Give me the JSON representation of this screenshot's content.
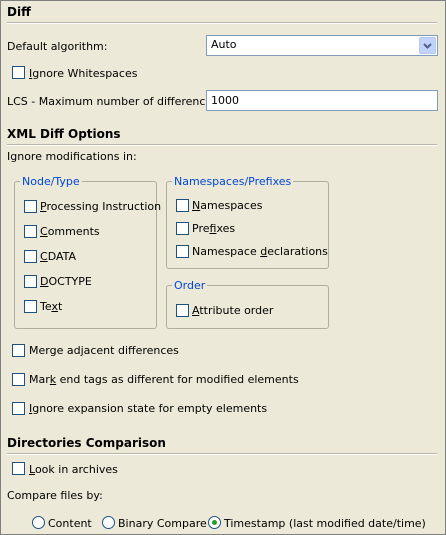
{
  "diff": {
    "title": "Diff",
    "default_algorithm_label": "Default algorithm:",
    "default_algorithm_value": "Auto",
    "ignore_whitespaces": {
      "pre": "",
      "mn": "I",
      "post": "gnore Whitespaces"
    },
    "lcs_label": "LCS - Maximum number of differences:",
    "lcs_value": "1000"
  },
  "xml": {
    "title": "XML Diff Options",
    "ignore_label": "Ignore modifications in:",
    "node_type": {
      "title": "Node/Type",
      "items": [
        {
          "pre": "",
          "mn": "P",
          "post": "rocessing Instruction"
        },
        {
          "pre": "",
          "mn": "C",
          "post": "omments"
        },
        {
          "pre": "",
          "mn": "C",
          "post": "DATA"
        },
        {
          "pre": "",
          "mn": "D",
          "post": "OCTYPE"
        },
        {
          "pre": "Te",
          "mn": "x",
          "post": "t"
        }
      ]
    },
    "namespaces": {
      "title": "Namespaces/Prefixes",
      "items": [
        {
          "pre": "",
          "mn": "N",
          "post": "amespaces"
        },
        {
          "pre": "Pre",
          "mn": "f",
          "post": "ixes"
        },
        {
          "pre": "Namespace ",
          "mn": "d",
          "post": "eclarations"
        }
      ]
    },
    "order": {
      "title": "Order",
      "item": {
        "pre": "",
        "mn": "A",
        "post": "ttribute order"
      }
    },
    "options": [
      {
        "pre": "Merge ad",
        "mn": "j",
        "post": "acent differences"
      },
      {
        "pre": "Mar",
        "mn": "k",
        "post": " end tags as different for modified elements"
      },
      {
        "pre": "",
        "mn": "I",
        "post": "gnore expansion state for empty elements"
      }
    ]
  },
  "dirs": {
    "title": "Directories Comparison",
    "look_archives": {
      "pre": "",
      "mn": "L",
      "post": "ook in archives"
    },
    "compare_label": "Compare files by:",
    "radios": [
      {
        "label": "Content",
        "selected": false
      },
      {
        "label": "Binary Compare",
        "selected": false
      },
      {
        "label": "Timestamp (last modified date/time)",
        "selected": true
      }
    ]
  },
  "colors": {
    "panel": "#ece9d8",
    "group_title": "#0046d5",
    "border": "#7f9db9",
    "radio_dot": "#21a121"
  },
  "icons": {
    "dropdown": "chevron-down-icon"
  }
}
